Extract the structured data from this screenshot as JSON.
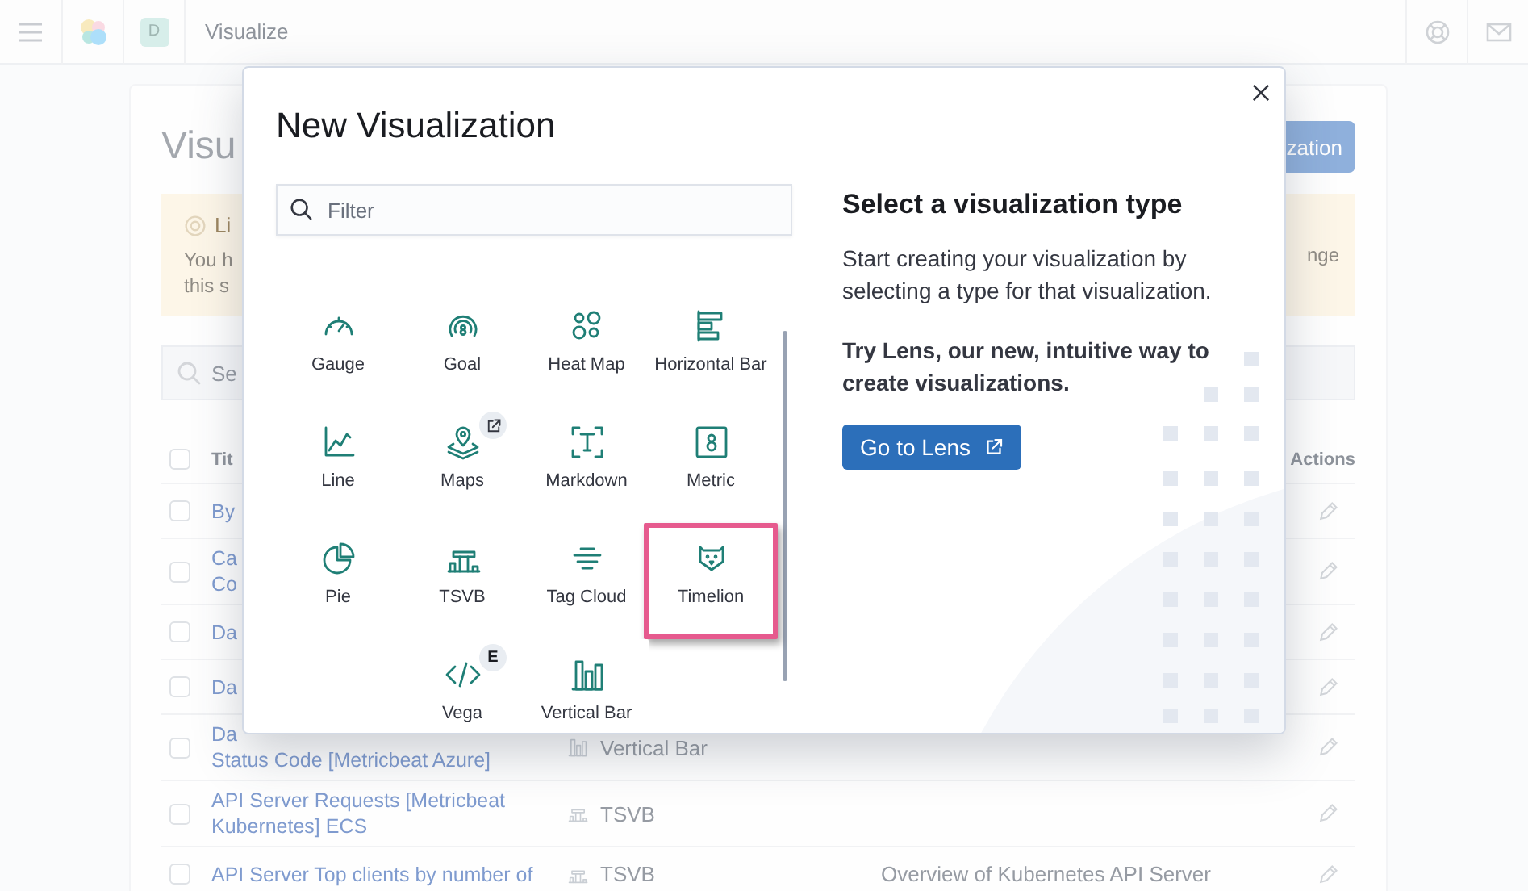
{
  "header": {
    "avatar": "D",
    "title": "Visualize"
  },
  "page": {
    "title": "Visu",
    "create_button": "zation",
    "callout": {
      "title": "Li",
      "lines": [
        "You h",
        "this s"
      ],
      "right_text": "nge"
    },
    "search": {
      "placeholder": "Se"
    },
    "table": {
      "columns": [
        "Tit",
        "Actions"
      ],
      "all_checked": false,
      "rows": [
        {
          "checked": false,
          "title_lines": [
            "By"
          ]
        },
        {
          "checked": false,
          "title_lines": [
            "Ca",
            "Co"
          ]
        },
        {
          "checked": false,
          "title_lines": [
            "Da"
          ]
        },
        {
          "checked": false,
          "title_lines": [
            "Da"
          ]
        },
        {
          "checked": false,
          "title_lines": [
            "Da",
            "Status Code [Metricbeat Azure]"
          ],
          "type": {
            "kind": "vertical_bar",
            "label": "Vertical Bar"
          }
        },
        {
          "checked": false,
          "title_lines": [
            "API Server Requests [Metricbeat",
            "Kubernetes] ECS"
          ],
          "type": {
            "kind": "tsvb",
            "label": "TSVB"
          }
        },
        {
          "checked": false,
          "title_lines": [
            "API Server Top clients by number of"
          ],
          "type": {
            "kind": "tsvb",
            "label": "TSVB"
          },
          "description": "Overview of Kubernetes API Server"
        }
      ]
    }
  },
  "modal": {
    "title": "New Visualization",
    "filter": {
      "placeholder": "Filter"
    },
    "items": [
      {
        "kind": "gauge",
        "label": "Gauge",
        "selected": false
      },
      {
        "kind": "goal",
        "label": "Goal",
        "selected": false
      },
      {
        "kind": "heat_map",
        "label": "Heat Map",
        "selected": false
      },
      {
        "kind": "horizontal_bar",
        "label": "Horizontal Bar",
        "selected": false
      },
      {
        "kind": "line",
        "label": "Line",
        "selected": false
      },
      {
        "kind": "maps",
        "label": "Maps",
        "selected": false,
        "badge": {
          "kind": "external"
        }
      },
      {
        "kind": "markdown",
        "label": "Markdown",
        "selected": false
      },
      {
        "kind": "metric",
        "label": "Metric",
        "selected": false
      },
      {
        "kind": "pie",
        "label": "Pie",
        "selected": false
      },
      {
        "kind": "tsvb",
        "label": "TSVB",
        "selected": false
      },
      {
        "kind": "tag_cloud",
        "label": "Tag Cloud",
        "selected": false
      },
      {
        "kind": "timelion",
        "label": "Timelion",
        "selected": true
      },
      {
        "kind": "empty"
      },
      {
        "kind": "vega",
        "label": "Vega",
        "selected": false,
        "badge": {
          "kind": "text",
          "text": "E"
        }
      },
      {
        "kind": "vertical_bar",
        "label": "Vertical Bar",
        "selected": false
      }
    ],
    "side": {
      "heading": "Select a visualization type",
      "text": "Start creating your visualization by selecting a type for that visualization.",
      "promo": "Try Lens, our new, intuitive way to create visualizations.",
      "button": "Go to Lens"
    }
  }
}
